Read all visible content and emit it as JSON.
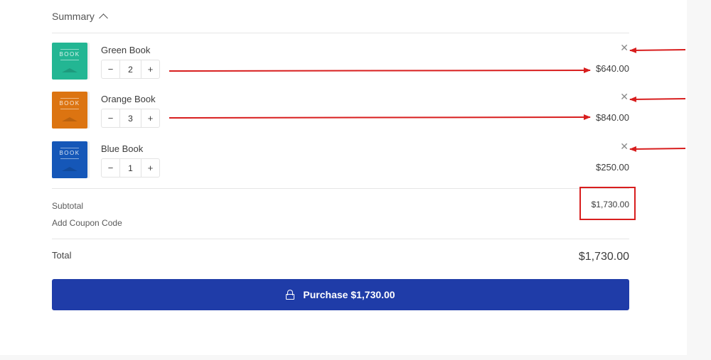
{
  "summary": {
    "title": "Summary",
    "toggle_icon": "chevron-up-icon"
  },
  "items": [
    {
      "name": "Green Book",
      "quantity": "2",
      "price": "$640.00",
      "cover_color": "#23b693",
      "cover_text": "BOOK",
      "remove_icon": "close-icon"
    },
    {
      "name": "Orange Book",
      "quantity": "3",
      "price": "$840.00",
      "cover_color": "#dc7411",
      "cover_text": "BOOK",
      "remove_icon": "close-icon"
    },
    {
      "name": "Blue Book",
      "quantity": "1",
      "price": "$250.00",
      "cover_color": "#1557b8",
      "cover_text": "BOOK",
      "remove_icon": "close-icon"
    }
  ],
  "stepper": {
    "decrement": "−",
    "increment": "+"
  },
  "totals": {
    "subtotal_label": "Subtotal",
    "subtotal_value": "$1,730.00",
    "coupon_label": "Add Coupon Code",
    "total_label": "Total",
    "total_value": "$1,730.00"
  },
  "purchase": {
    "label": "Purchase $1,730.00",
    "icon": "lock-icon",
    "color": "#1f3ca8"
  },
  "annotations": {
    "color": "#d81e1e"
  }
}
